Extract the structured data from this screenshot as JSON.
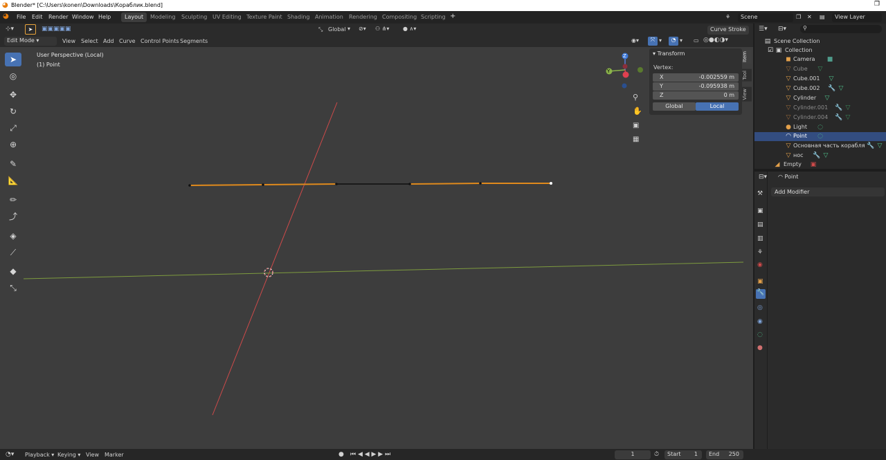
{
  "title": "Blender* [C:\\Users\\konen\\Downloads\\Кораблик.blend]",
  "menu": [
    "File",
    "Edit",
    "Render",
    "Window",
    "Help"
  ],
  "workspaces": [
    "Layout",
    "Modeling",
    "Sculpting",
    "UV Editing",
    "Texture Paint",
    "Shading",
    "Animation",
    "Rendering",
    "Compositing",
    "Scripting"
  ],
  "scene": {
    "label": "Scene",
    "viewlayer": "View Layer"
  },
  "vp": {
    "transform_orientation": "Global",
    "mode": "Edit Mode",
    "menus": [
      "View",
      "Select",
      "Add",
      "Curve",
      "Control Points",
      "Segments"
    ],
    "curve_stroke": "Curve Stroke",
    "overlay1": "User Perspective (Local)",
    "overlay2": "(1) Point"
  },
  "gizmo": {
    "z": "Z",
    "y": "Y"
  },
  "npanel": {
    "title": "Transform",
    "vertex": "Vertex:",
    "x_label": "X",
    "x_val": "-0.002559 m",
    "y_label": "Y",
    "y_val": "-0.095938 m",
    "z_label": "Z",
    "z_val": "0 m",
    "global": "Global",
    "local": "Local",
    "tabs": [
      "Item",
      "Tool",
      "View"
    ]
  },
  "outliner": {
    "scene_collection": "Scene Collection",
    "collection": "Collection",
    "items": [
      "Camera",
      "Cube",
      "Cube.001",
      "Cube.002",
      "Cylinder",
      "Cylinder.001",
      "Cylinder.004",
      "Light",
      "Point",
      "Основная часть корабля",
      "нос",
      "Empty"
    ]
  },
  "props": {
    "object": "Point",
    "add_modifier": "Add Modifier"
  },
  "timeline": {
    "menus": [
      "Playback",
      "Keying",
      "View",
      "Marker"
    ],
    "frame": "1",
    "start_label": "Start",
    "start": "1",
    "end_label": "End",
    "end": "250"
  },
  "colors": {
    "accent": "#4772b3",
    "x_axis": "#d04a4a",
    "y_axis": "#8ab34a",
    "curve": "#e08a1c"
  }
}
